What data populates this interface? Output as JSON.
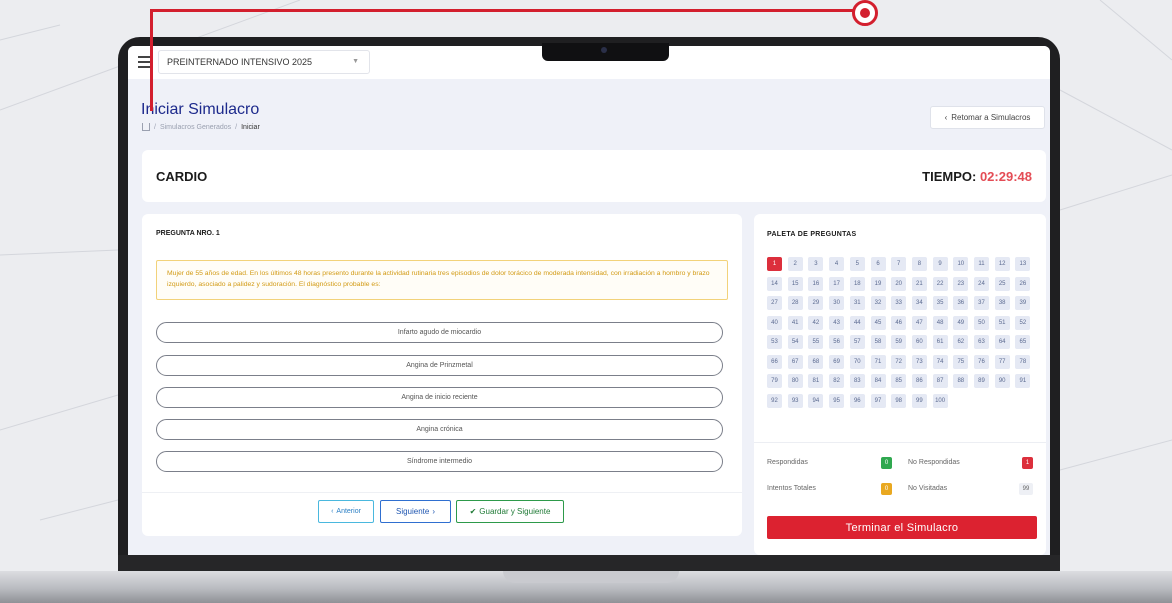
{
  "header": {
    "course_select": "PREINTERNADO INTENSIVO 2025"
  },
  "page": {
    "title": "Iniciar Simulacro",
    "breadcrumb": [
      "Simulacros Generados",
      "Iniciar"
    ],
    "return_button": "Retomar a Simulacros"
  },
  "exam": {
    "subject": "CARDIO",
    "timer_label": "TIEMPO:",
    "timer_value": "02:29:48"
  },
  "question": {
    "heading": "PREGUNTA NRO. 1",
    "text": "Mujer de 55 años de edad. En los últimos 48 horas presento durante la actividad rutinaria tres episodios de dolor torácico de moderada intensidad, con irradiación a hombro y brazo izquierdo, asociado a palidez y sudoración. El diagnóstico probable es:",
    "options": [
      "Infarto agudo de miocardio",
      "Angina de Prinzmetal",
      "Angina de inicio reciente",
      "Angina crónica",
      "Síndrome intermedio"
    ]
  },
  "navigation": {
    "prev": "Anterior",
    "next": "Siguiente",
    "save_next": "Guardar y Siguiente"
  },
  "palette": {
    "title": "PALETA DE PREGUNTAS",
    "total": 100,
    "current": 1,
    "legend": {
      "answered_label": "Respondidas",
      "answered_count": "0",
      "unanswered_label": "No Respondidas",
      "unanswered_count": "1",
      "attempts_label": "Intentos Totales",
      "attempts_count": "0",
      "unvisited_label": "No Visitadas",
      "unvisited_count": "99"
    },
    "finish_button": "Terminar el Simulacro"
  },
  "colors": {
    "accent_red": "#dc2230",
    "title_blue": "#1d2a8c",
    "timer_red": "#e44c55",
    "answered_green": "#2fa84f",
    "attempts_yellow": "#e9a820"
  }
}
